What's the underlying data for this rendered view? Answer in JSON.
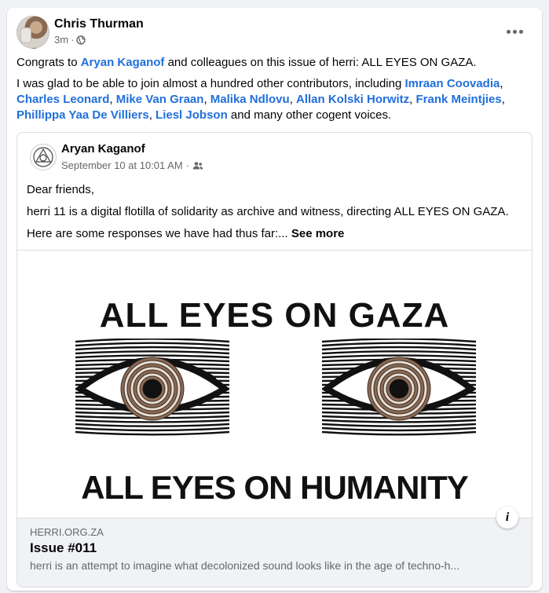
{
  "post": {
    "author": "Chris Thurman",
    "time": "3m",
    "separator": "·",
    "text": {
      "p1": [
        {
          "t": "Congrats to ",
          "link": false
        },
        {
          "t": "Aryan Kaganof",
          "link": true
        },
        {
          "t": " and colleagues on this issue of herri: ALL EYES ON GAZA.",
          "link": false
        }
      ],
      "p2": [
        {
          "t": "I was glad to be able to join almost a hundred other contributors, including ",
          "link": false
        },
        {
          "t": "Imraan Coovadia",
          "link": true
        },
        {
          "t": ", ",
          "link": false
        },
        {
          "t": "Charles Leonard",
          "link": true
        },
        {
          "t": ", ",
          "link": false
        },
        {
          "t": "Mike Van Graan",
          "link": true
        },
        {
          "t": ", ",
          "link": false
        },
        {
          "t": "Malika Ndlovu",
          "link": true
        },
        {
          "t": ", ",
          "link": false
        },
        {
          "t": "Allan Kolski Horwitz",
          "link": true
        },
        {
          "t": ", ",
          "link": false
        },
        {
          "t": "Frank Meintjies",
          "link": true
        },
        {
          "t": ", ",
          "link": false
        },
        {
          "t": "Phillippa Yaa De Villiers",
          "link": true
        },
        {
          "t": ", ",
          "link": false
        },
        {
          "t": "Liesl Jobson",
          "link": true
        },
        {
          "t": " and many other cogent voices.",
          "link": false
        }
      ]
    }
  },
  "shared": {
    "author": "Aryan Kaganof",
    "date": "September 10 at 10:01 AM",
    "separator": "·",
    "line1": "Dear friends,",
    "line2": "herri 11 is a digital flotilla of solidarity as archive and witness, directing ALL EYES ON GAZA.",
    "line3": "Here are some responses we have had thus far:...",
    "see_more": "See more",
    "poster_top": "ALL EYES ON GAZA",
    "poster_bottom": "ALL EYES ON HUMANITY"
  },
  "link_preview": {
    "domain": "HERRI.ORG.ZA",
    "title": "Issue #011",
    "description": "herri is an attempt to imagine what decolonized sound looks like in the age of techno-h...",
    "info_glyph": "i"
  },
  "colors": {
    "link": "#216fdb",
    "meta": "#65676b",
    "background": "#f0f2f5"
  }
}
